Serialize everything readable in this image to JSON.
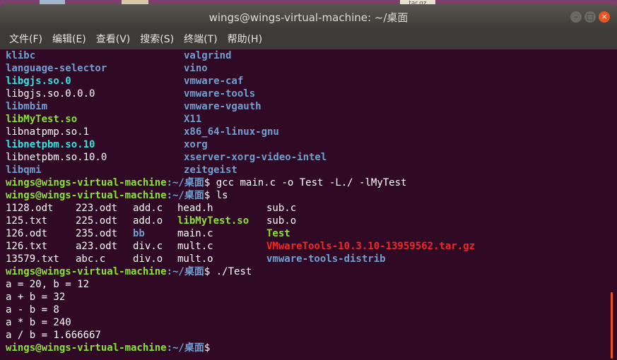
{
  "desktop": {
    "file_label": "tar.gz"
  },
  "window": {
    "title": "wings@wings-virtual-machine: ~/桌面",
    "controls": {
      "minimize": "–",
      "maximize": "□",
      "close": "×"
    },
    "menu": [
      "文件(F)",
      "编辑(E)",
      "查看(V)",
      "搜索(S)",
      "终端(T)",
      "帮助(H)"
    ]
  },
  "terminal": {
    "prompt_user": "wings@wings-virtual-machine",
    "prompt_path": ":~/桌面",
    "prompt_symbol": "$",
    "listing_top": [
      [
        "klibc",
        "valgrind"
      ],
      [
        "language-selector",
        "vino"
      ],
      [
        "libgjs.so.0",
        "vmware-caf"
      ],
      [
        "libgjs.so.0.0.0",
        "vmware-tools"
      ],
      [
        "libmbim",
        "vmware-vgauth"
      ],
      [
        "libMyTest.so",
        "X11"
      ],
      [
        "libnatpmp.so.1",
        "x86_64-linux-gnu"
      ],
      [
        "libnetpbm.so.10",
        "xorg"
      ],
      [
        "libnetpbm.so.10.0",
        "xserver-xorg-video-intel"
      ],
      [
        "libqmi",
        "zeitgeist"
      ]
    ],
    "cmd1": " gcc main.c -o Test -L./ -lMyTest",
    "cmd2": " ls",
    "ls_rows": [
      [
        "1128.odt",
        "223.odt",
        "add.c",
        "head.h",
        "sub.c"
      ],
      [
        "125.txt",
        "225.odt",
        "add.o",
        "libMyTest.so",
        "sub.o"
      ],
      [
        "126.odt",
        "235.odt",
        "bb",
        "main.c",
        "Test"
      ],
      [
        "126.txt",
        "a23.odt",
        "div.c",
        "mult.c",
        "VMwareTools-10.3.10-13959562.tar.gz"
      ],
      [
        "13579.txt",
        "abc.c",
        "div.o",
        "mult.o",
        "vmware-tools-distrib"
      ]
    ],
    "cmd3": " ./Test",
    "output": [
      "a = 20, b = 12",
      "a + b = 32",
      "a - b = 8",
      "a * b = 240",
      "a / b = 1.666667"
    ],
    "colors": {
      "background": "#300a24",
      "directory": "#729fcf",
      "symlink": "#34e2e2",
      "executable": "#8ae234",
      "archive": "#ef2929",
      "accent": "#e95420"
    }
  }
}
